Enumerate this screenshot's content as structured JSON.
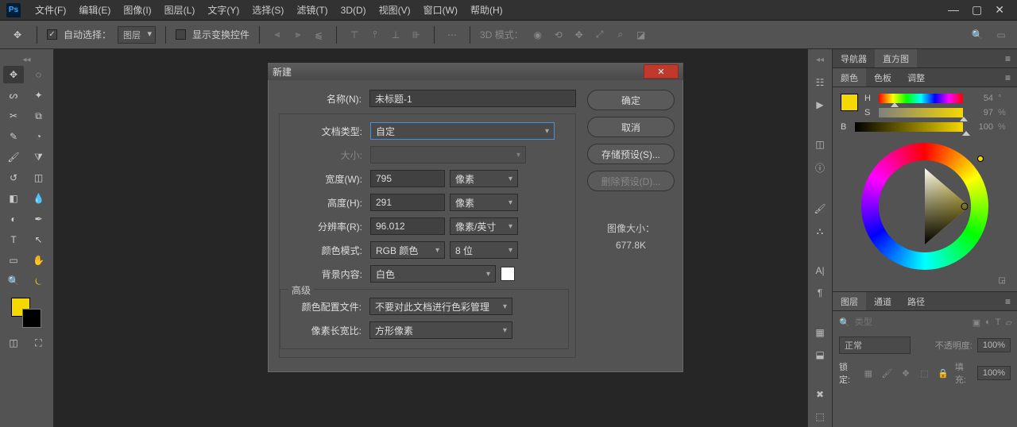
{
  "menu": {
    "items": [
      "文件(F)",
      "编辑(E)",
      "图像(I)",
      "图层(L)",
      "文字(Y)",
      "选择(S)",
      "滤镜(T)",
      "3D(D)",
      "视图(V)",
      "窗口(W)",
      "帮助(H)"
    ]
  },
  "optbar": {
    "auto_select": "自动选择：",
    "layer": "图层",
    "show_transform": "显示变换控件",
    "mode3d": "3D 模式："
  },
  "dialog": {
    "title": "新建",
    "name_lbl": "名称(N):",
    "name_val": "未标题-1",
    "doctype_lbl": "文档类型:",
    "doctype_val": "自定",
    "size_lbl": "大小:",
    "width_lbl": "宽度(W):",
    "width_val": "795",
    "width_unit": "像素",
    "height_lbl": "高度(H):",
    "height_val": "291",
    "height_unit": "像素",
    "res_lbl": "分辨率(R):",
    "res_val": "96.012",
    "res_unit": "像素/英寸",
    "cmode_lbl": "颜色模式:",
    "cmode_val": "RGB 颜色",
    "cdepth_val": "8 位",
    "bg_lbl": "背景内容:",
    "bg_val": "白色",
    "advanced": "高级",
    "profile_lbl": "颜色配置文件:",
    "profile_val": "不要对此文档进行色彩管理",
    "aspect_lbl": "像素长宽比:",
    "aspect_val": "方形像素",
    "ok": "确定",
    "cancel": "取消",
    "save_preset": "存储预设(S)...",
    "del_preset": "删除预设(D)...",
    "imgsize_lbl": "图像大小：",
    "imgsize_val": "677.8K"
  },
  "rpanel": {
    "tabs_top": [
      "导航器",
      "直方图"
    ],
    "tabs_color": [
      "颜色",
      "色板",
      "调整"
    ],
    "H": "H",
    "S": "S",
    "B": "B",
    "h_val": "54",
    "s_val": "97",
    "b_val": "100",
    "tabs_layer": [
      "图层",
      "通道",
      "路径"
    ],
    "search_ph": "类型",
    "blend": "正常",
    "opacity_lbl": "不透明度:",
    "opacity_val": "100%",
    "lock_lbl": "锁定:",
    "fill_lbl": "填充:",
    "fill_val": "100%"
  }
}
